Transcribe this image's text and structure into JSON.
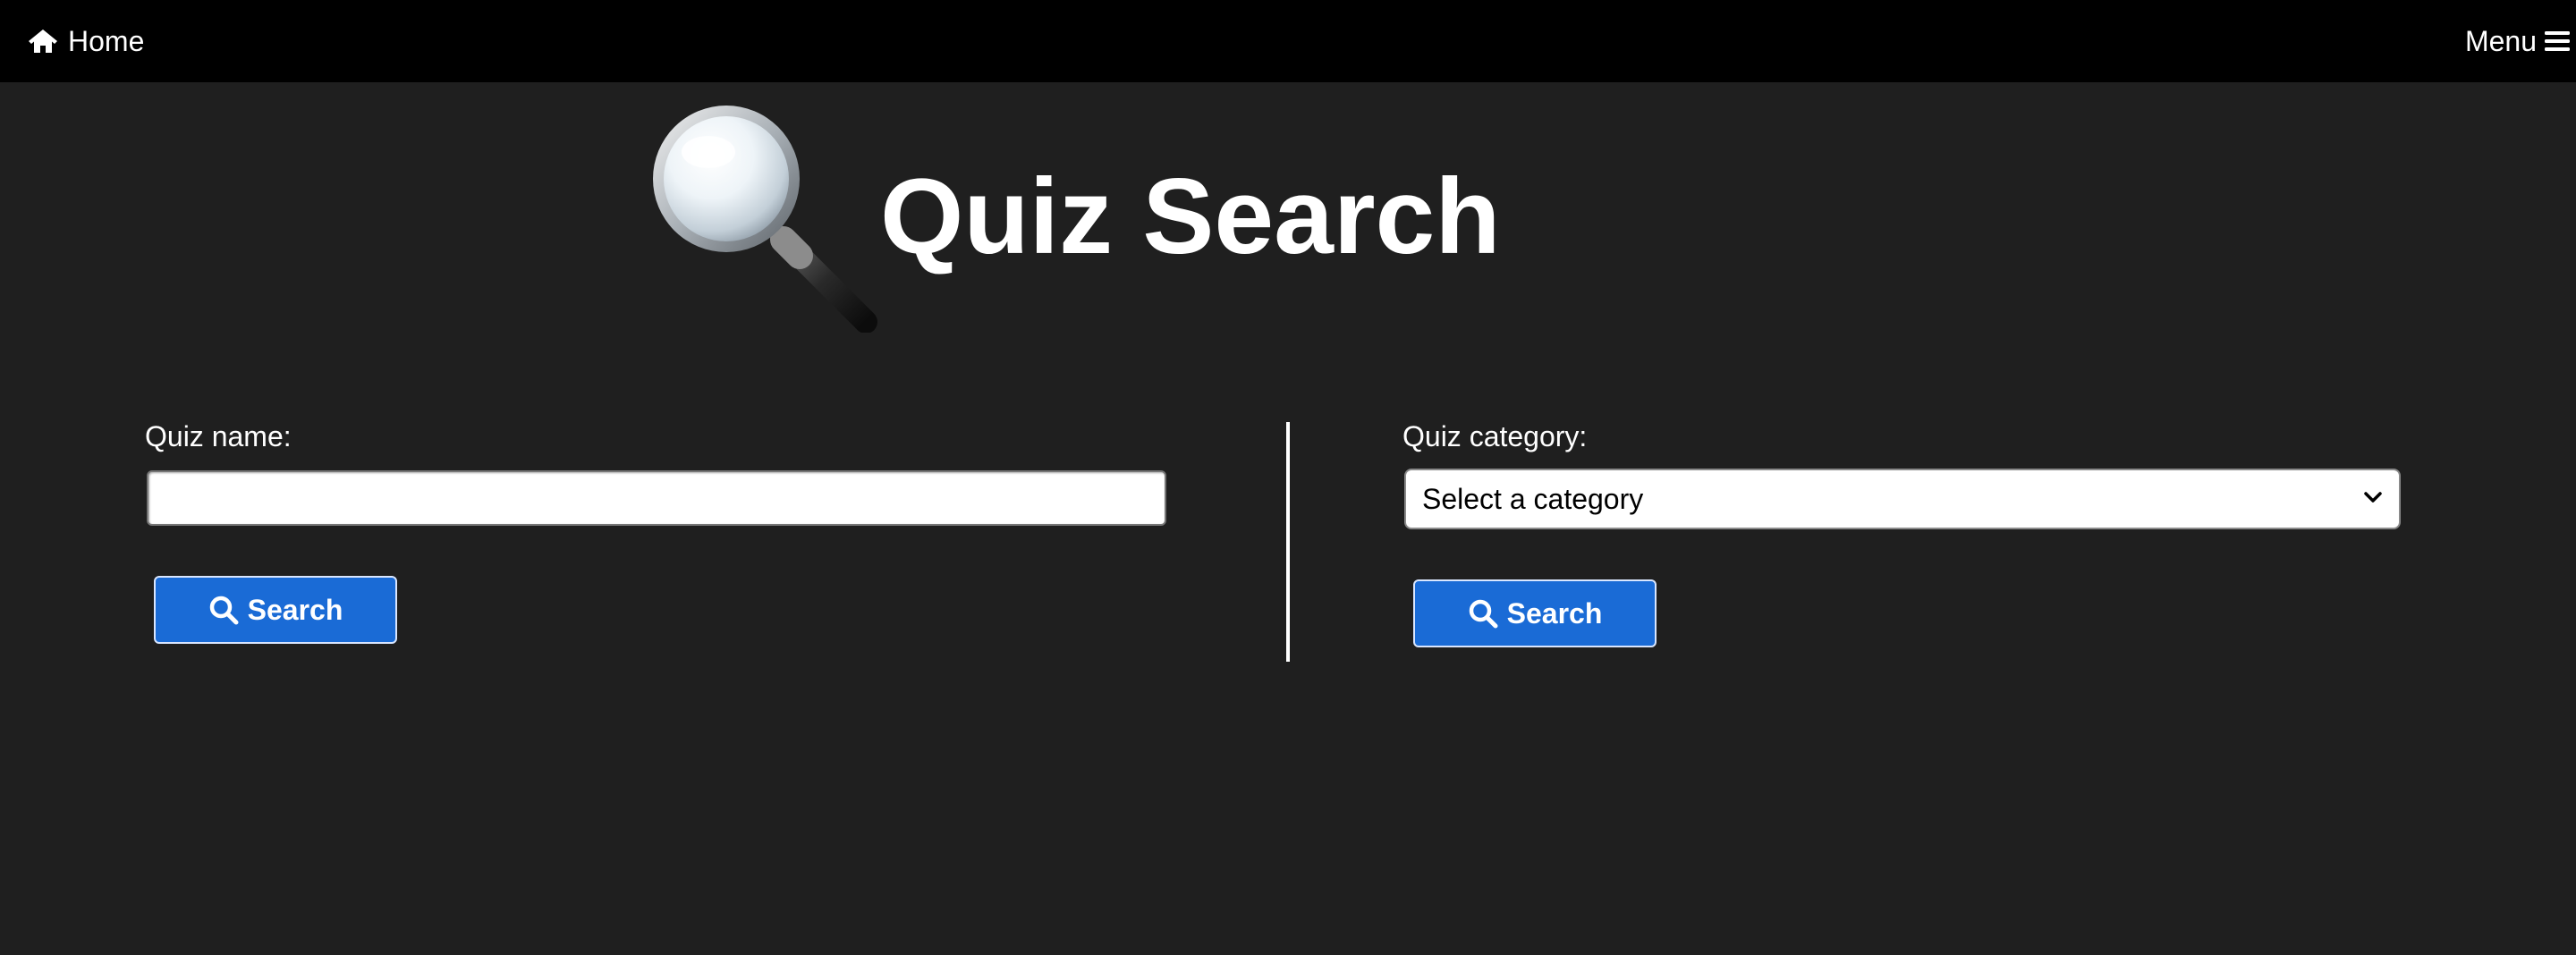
{
  "nav": {
    "home_label": "Home",
    "home_icon": "home-icon",
    "menu_label": "Menu",
    "menu_icon": "hamburger-icon"
  },
  "header": {
    "title": "Quiz Search",
    "icon": "magnifying-glass-icon"
  },
  "name_search": {
    "label": "Quiz name:",
    "value": "",
    "button_label": "Search",
    "button_icon": "search-icon"
  },
  "category_search": {
    "label": "Quiz category:",
    "selected": "Select a category",
    "button_label": "Search",
    "button_icon": "search-icon"
  },
  "colors": {
    "background": "#1f1f1f",
    "navbar": "#000000",
    "button": "#1a6bd6",
    "text": "#ffffff"
  }
}
